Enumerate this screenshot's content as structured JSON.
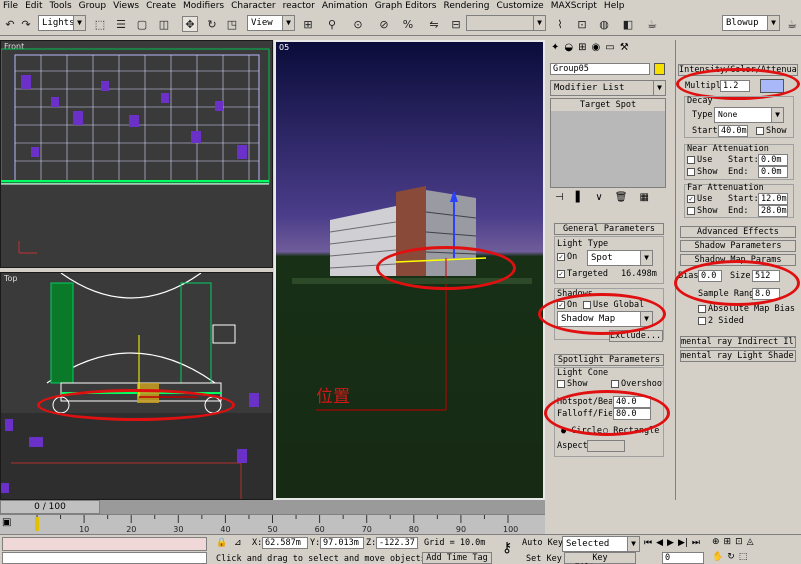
{
  "menu": [
    "File",
    "Edit",
    "Tools",
    "Group",
    "Views",
    "Create",
    "Modifiers",
    "Character",
    "reactor",
    "Animation",
    "Graph Editors",
    "Rendering",
    "Customize",
    "MAXScript",
    "Help"
  ],
  "toolbar": {
    "selection_filter": "Lights",
    "ref_coord": "View",
    "render_type": "Blowup"
  },
  "viewports": {
    "front_label": "Front",
    "top_label": "Top",
    "persp_label": "05"
  },
  "annotation": {
    "position_text": "位置"
  },
  "command_panel": {
    "object_name": "Group05",
    "object_color": "#f5e000",
    "modifier_list": "Modifier List",
    "stack_item": "Target Spot",
    "general": {
      "title": "General Parameters",
      "light_type_label": "Light Type",
      "on_label": "On",
      "type_value": "Spot",
      "targeted_label": "Targeted",
      "target_distance": "16.498m",
      "shadows_label": "Shadows",
      "shadows_on_label": "On",
      "use_global_label": "Use Global",
      "shadow_type": "Shadow Map",
      "exclude_label": "Exclude..."
    },
    "spotlight": {
      "title": "Spotlight Parameters",
      "light_cone_label": "Light Cone",
      "show_cone_label": "Show",
      "overshoot_label": "Overshoot",
      "hotspot_label": "Hotspot/Beam:",
      "hotspot_value": "40.0",
      "falloff_label": "Falloff/Field:",
      "falloff_value": "80.0",
      "circle_label": "Circle",
      "rect_label": "Rectangle",
      "aspect_label": "Aspect:"
    },
    "intensity": {
      "title": "Intensity/Color/Attenuation",
      "multiplier_label": "Multiplier:",
      "multiplier_value": "1.2",
      "light_color": "#a8b8f8",
      "decay_label": "Decay",
      "decay_type_label": "Type:",
      "decay_type_value": "None",
      "decay_start_label": "Start:",
      "decay_start_value": "40.0m",
      "decay_show_label": "Show",
      "near_label": "Near Attenuation",
      "near_use_label": "Use",
      "near_start_label": "Start:",
      "near_start_value": "0.0m",
      "near_show_label": "Show",
      "near_end_label": "End:",
      "near_end_value": "0.0m",
      "far_label": "Far Attenuation",
      "far_use_label": "Use",
      "far_start_label": "Start:",
      "far_start_value": "12.0m",
      "far_show_label": "Show",
      "far_end_label": "End:",
      "far_end_value": "28.0m"
    },
    "rollouts": [
      "Advanced Effects",
      "Shadow Parameters"
    ],
    "shadow_map": {
      "title": "Shadow Map Params",
      "bias_label": "Bias:",
      "bias_value": "0.0",
      "size_label": "Size:",
      "size_value": "512",
      "sample_range_label": "Sample Range:",
      "sample_range_value": "8.0",
      "absolute_label": "Absolute Map Bias",
      "two_sided_label": "2 Sided"
    },
    "mental_ray": [
      "mental ray Indirect Illumination",
      "mental ray Light Shader"
    ]
  },
  "timeline": {
    "frame_display": "0 / 100",
    "ticks": [
      "0",
      "10",
      "20",
      "30",
      "40",
      "50",
      "60",
      "70",
      "80",
      "90",
      "100"
    ]
  },
  "status": {
    "x_label": "X:",
    "x_value": "62.587m",
    "y_label": "Y:",
    "y_value": "97.013m",
    "z_label": "Z:",
    "z_value": "-122.37",
    "grid": "Grid = 10.0m",
    "prompt": "Click and drag to select and move objects",
    "add_time_tag": "Add Time Tag",
    "auto_key": "Auto Key",
    "auto_key_mode": "Selected",
    "set_key": "Set Key",
    "key_filters": "Key Filters...",
    "frame_value": "0"
  },
  "colors": {
    "highlight": "#e01010",
    "wire_green": "#00d060",
    "wire_blue": "#7b3cd8"
  }
}
